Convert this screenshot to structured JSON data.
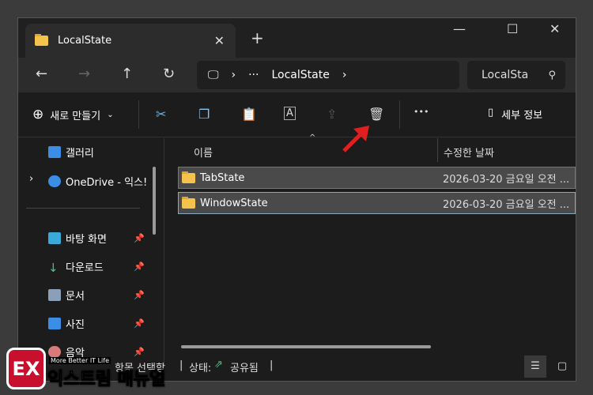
{
  "tab": {
    "title": "LocalState",
    "close": "✕",
    "new": "+"
  },
  "window": {
    "minimize": "—",
    "maximize": "☐",
    "close": "✕"
  },
  "nav": {
    "back": "←",
    "forward": "→",
    "up": "↑",
    "refresh": "↻",
    "path_more": "···",
    "path": "LocalState",
    "search_placeholder": "LocalSta"
  },
  "toolbar": {
    "new_label": "새로 만들기",
    "more": "•••",
    "details": "세부 정보"
  },
  "sidebar": {
    "items": [
      {
        "label": "갤러리"
      },
      {
        "label": "OneDrive - 익스!"
      },
      {
        "label": "바탕 화면"
      },
      {
        "label": "다운로드"
      },
      {
        "label": "문서"
      },
      {
        "label": "사진"
      },
      {
        "label": "음악"
      }
    ]
  },
  "columns": {
    "name": "이름",
    "modified": "수정한 날짜"
  },
  "files": [
    {
      "name": "TabState",
      "modified": "2026-03-20 금요일 오전 ..."
    },
    {
      "name": "WindowState",
      "modified": "2026-03-20 금요일 오전 ..."
    }
  ],
  "status": {
    "selected": "항목 선택함",
    "state_label": "상태:",
    "state": "공유됨"
  },
  "watermark": {
    "tagline": "More Better IT Life",
    "name": "익스트림 매뉴얼"
  }
}
